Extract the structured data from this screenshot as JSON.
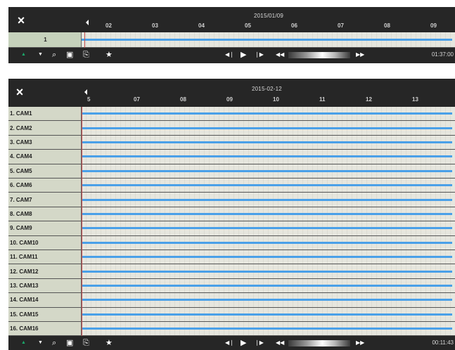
{
  "top_panel": {
    "date": "2015/01/09",
    "hours": [
      "02",
      "03",
      "04",
      "05",
      "06",
      "07",
      "08",
      "09"
    ],
    "rows": [
      {
        "label": "1"
      }
    ],
    "time": "01:37:00"
  },
  "bottom_panel": {
    "date": "2015-02-12",
    "hours": [
      "5",
      "07",
      "08",
      "09",
      "10",
      "11",
      "12",
      "13"
    ],
    "rows": [
      {
        "label": "1. CAM1"
      },
      {
        "label": "2. CAM2"
      },
      {
        "label": "3. CAM3"
      },
      {
        "label": "4. CAM4"
      },
      {
        "label": "5. CAM5"
      },
      {
        "label": "6. CAM6"
      },
      {
        "label": "7. CAM7"
      },
      {
        "label": "8. CAM8"
      },
      {
        "label": "9. CAM9"
      },
      {
        "label": "10. CAM10"
      },
      {
        "label": "11. CAM11"
      },
      {
        "label": "12. CAM12"
      },
      {
        "label": "13. CAM13"
      },
      {
        "label": "14. CAM14"
      },
      {
        "label": "15. CAM15"
      },
      {
        "label": "16. CAM16"
      }
    ],
    "time": "00:11:43"
  },
  "colors": {
    "panel_bg": "#262626",
    "recording_bar": "#4aa0e8",
    "accent_green": "#1aa86a"
  },
  "toolbar_icons": [
    "up-arrow-icon",
    "down-arrow-icon",
    "zoom-icon",
    "calendar-icon",
    "export-icon",
    "star-icon",
    "step-back-icon",
    "play-icon",
    "step-forward-icon",
    "rewind-icon",
    "fast-forward-icon"
  ]
}
